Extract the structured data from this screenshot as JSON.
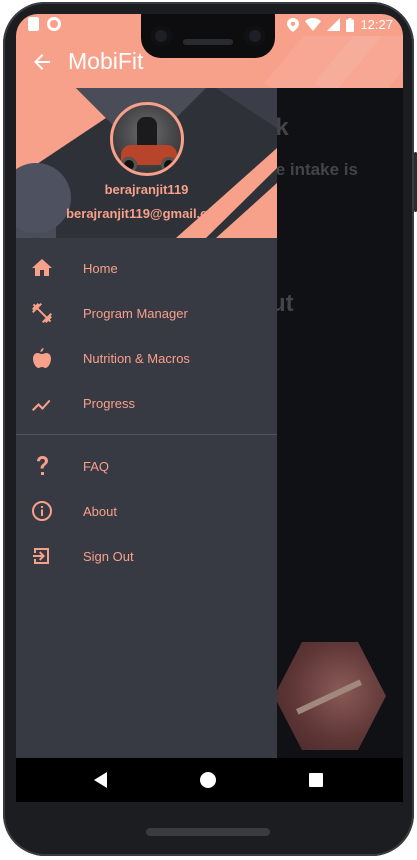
{
  "status_bar": {
    "time": "12:27"
  },
  "app_bar": {
    "title": "MobiFit",
    "back_icon": "arrow-left-icon"
  },
  "background_page": {
    "fragments": [
      "ck",
      "ie intake is",
      "ut"
    ]
  },
  "drawer": {
    "user": {
      "name": "berajranjit119",
      "email": "berajranjit119@gmail.com"
    },
    "primary_items": [
      {
        "label": "Home",
        "icon": "home-icon"
      },
      {
        "label": "Program Manager",
        "icon": "dumbbell-icon"
      },
      {
        "label": "Nutrition & Macros",
        "icon": "apple-icon"
      },
      {
        "label": "Progress",
        "icon": "trending-up-icon"
      }
    ],
    "secondary_items": [
      {
        "label": "FAQ",
        "icon": "question-icon"
      },
      {
        "label": "About",
        "icon": "info-icon"
      },
      {
        "label": "Sign Out",
        "icon": "sign-out-icon"
      }
    ]
  },
  "colors": {
    "accent": "#f7a08a",
    "drawer_bg": "#383a43",
    "page_bg": "#16171d"
  }
}
